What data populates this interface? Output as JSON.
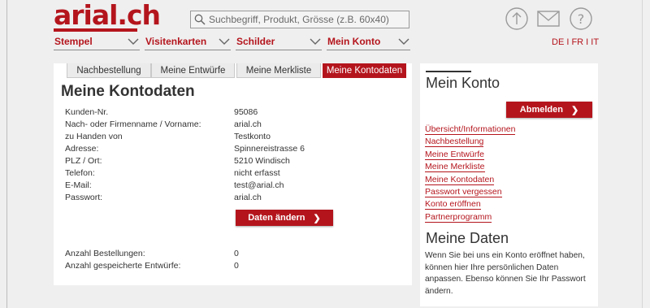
{
  "logo": {
    "text": "arial.ch"
  },
  "search": {
    "placeholder": "Suchbegriff, Produkt, Grösse (z.B. 60x40)"
  },
  "header_icons": [
    "upload-icon",
    "mail-icon",
    "help-icon"
  ],
  "nav": [
    {
      "label": "Stempel"
    },
    {
      "label": "Visitenkarten"
    },
    {
      "label": "Schilder"
    },
    {
      "label": "Mein Konto"
    }
  ],
  "languages": "DE I FR I IT",
  "tabs": [
    {
      "label": "Nachbestellung"
    },
    {
      "label": "Meine Entwürfe"
    },
    {
      "label": "Meine Merkliste"
    },
    {
      "label": "Meine Kontodaten"
    }
  ],
  "main": {
    "title": "Meine Kontodaten",
    "fields": [
      {
        "label": "Kunden-Nr.",
        "value": "95086"
      },
      {
        "label": "Nach- oder Firmenname / Vorname:",
        "value": "arial.ch"
      },
      {
        "label": "zu Handen von",
        "value": "Testkonto"
      },
      {
        "label": "Adresse:",
        "value": "Spinnereistrasse 6"
      },
      {
        "label": "PLZ / Ort:",
        "value": "5210 Windisch"
      },
      {
        "label": "Telefon:",
        "value": "nicht erfasst"
      },
      {
        "label": "E-Mail:",
        "value": "test@arial.ch"
      },
      {
        "label": "Passwort:",
        "value": "arial.ch"
      }
    ],
    "edit_button": "Daten ändern",
    "stats": [
      {
        "label": "Anzahl Bestellungen:",
        "value": "0"
      },
      {
        "label": "Anzahl gespeicherte Entwürfe:",
        "value": "0"
      }
    ]
  },
  "side": {
    "title": "Mein Konto",
    "logout_button": "Abmelden",
    "links": [
      "Übersicht/Informationen",
      "Nachbestellung",
      "Meine Entwürfe",
      "Meine Merkliste",
      "Meine Kontodaten",
      "Passwort vergessen",
      "Konto eröffnen",
      "Partnerprogramm"
    ],
    "data_title": "Meine Daten",
    "data_text": "Wenn Sie bei uns ein Konto eröffnet haben, können hier Ihre persönlichen Daten anpassen. Ebenso können Sie Ihr Passwort ändern."
  },
  "colors": {
    "brand": "#b4151d",
    "background": "#efefef",
    "panel": "#ffffff"
  }
}
